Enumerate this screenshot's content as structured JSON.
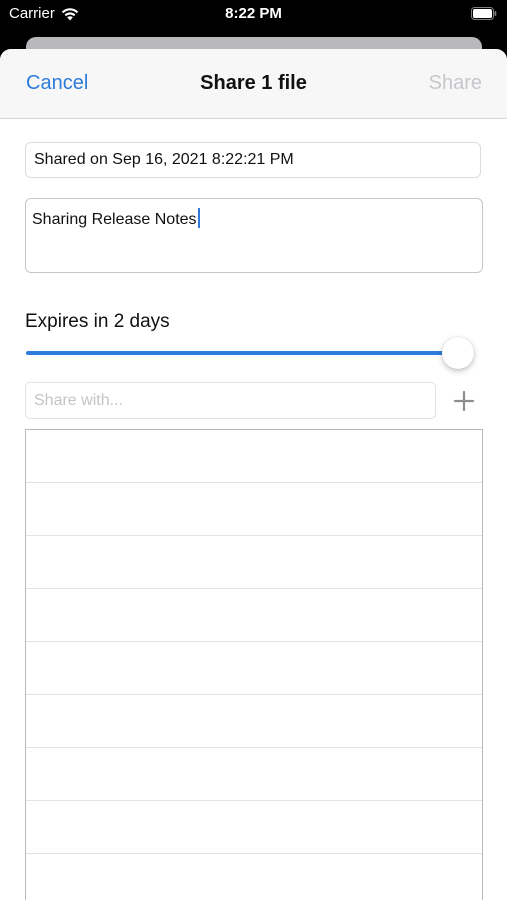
{
  "status_bar": {
    "carrier": "Carrier",
    "time": "8:22 PM",
    "icons": [
      "wifi-icon",
      "battery-icon"
    ]
  },
  "nav": {
    "cancel_label": "Cancel",
    "title": "Share 1 file",
    "share_label": "Share",
    "share_enabled": false
  },
  "form": {
    "shared_name_value": "Shared on Sep 16, 2021 8:22:21 PM",
    "notes_value": "Sharing Release Notes",
    "expires_label": "Expires in 2 days",
    "expiry_slider_fraction": 1.0,
    "share_with_placeholder": "Share with...",
    "share_with_value": "",
    "add_icon": "plus-icon"
  },
  "recipients": {
    "rows": [
      "",
      "",
      "",
      "",
      "",
      "",
      "",
      "",
      ""
    ]
  },
  "colors": {
    "accent": "#2f7bdc",
    "disabled": "#c7c7cc",
    "nav_background": "#f7f7f7"
  }
}
